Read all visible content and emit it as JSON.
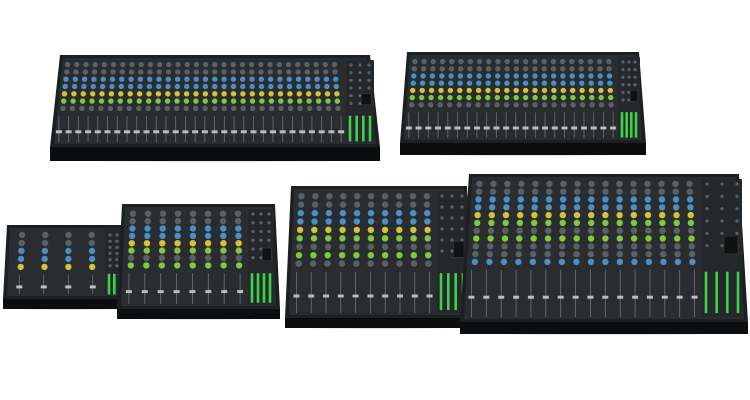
{
  "scene": {
    "background": "#ffffff",
    "mixers": [
      {
        "name": "mixer-32-channel",
        "channels": 30,
        "tilt": "back-row"
      },
      {
        "name": "mixer-22-channel",
        "channels": 22,
        "tilt": "back-row"
      },
      {
        "name": "mixer-4-channel",
        "channels": 4,
        "tilt": "front-row"
      },
      {
        "name": "mixer-8-channel",
        "channels": 8,
        "tilt": "front-row"
      },
      {
        "name": "mixer-12-channel",
        "channels": 10,
        "tilt": "front-row"
      },
      {
        "name": "mixer-16-channel",
        "channels": 16,
        "tilt": "front-row"
      }
    ],
    "colors": {
      "body": "#1d2021",
      "panel": "#2a2d2f",
      "edge": "#0c0d0e",
      "knob": "#5a6166",
      "knob_blue": "#4a8fc4",
      "knob_green": "#7fc93a",
      "knob_yellow": "#d6c13a",
      "fader_green": "#3fcf4a",
      "fader_track": "#6d7377"
    }
  }
}
